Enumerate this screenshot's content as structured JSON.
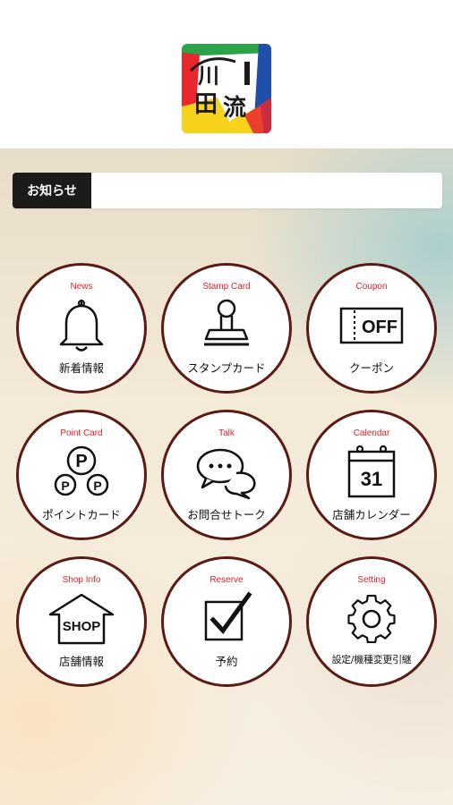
{
  "header": {
    "logo_alt": "川田流",
    "logo_icon": "shop-logo-icon"
  },
  "news": {
    "label": "お知らせ",
    "text": ""
  },
  "menu": [
    {
      "en": "News",
      "jp": "新着情報",
      "icon": "bell-icon"
    },
    {
      "en": "Stamp Card",
      "jp": "スタンプカード",
      "icon": "stamp-icon"
    },
    {
      "en": "Coupon",
      "jp": "クーポン",
      "icon": "coupon-icon",
      "icon_text": "OFF"
    },
    {
      "en": "Point Card",
      "jp": "ポイントカード",
      "icon": "point-card-icon",
      "icon_text": "P"
    },
    {
      "en": "Talk",
      "jp": "お問合せトーク",
      "icon": "chat-bubbles-icon"
    },
    {
      "en": "Calendar",
      "jp": "店舗カレンダー",
      "icon": "calendar-icon",
      "icon_text": "31"
    },
    {
      "en": "Shop Info",
      "jp": "店舗情報",
      "icon": "shop-icon",
      "icon_text": "SHOP"
    },
    {
      "en": "Reserve",
      "jp": "予約",
      "icon": "checkbox-icon"
    },
    {
      "en": "Setting",
      "jp": "設定/機種変更引継",
      "icon": "gear-icon"
    }
  ],
  "colors": {
    "accent": "#e4202a",
    "ring": "#5b1a14",
    "news_label_bg": "#1b1b1b"
  }
}
